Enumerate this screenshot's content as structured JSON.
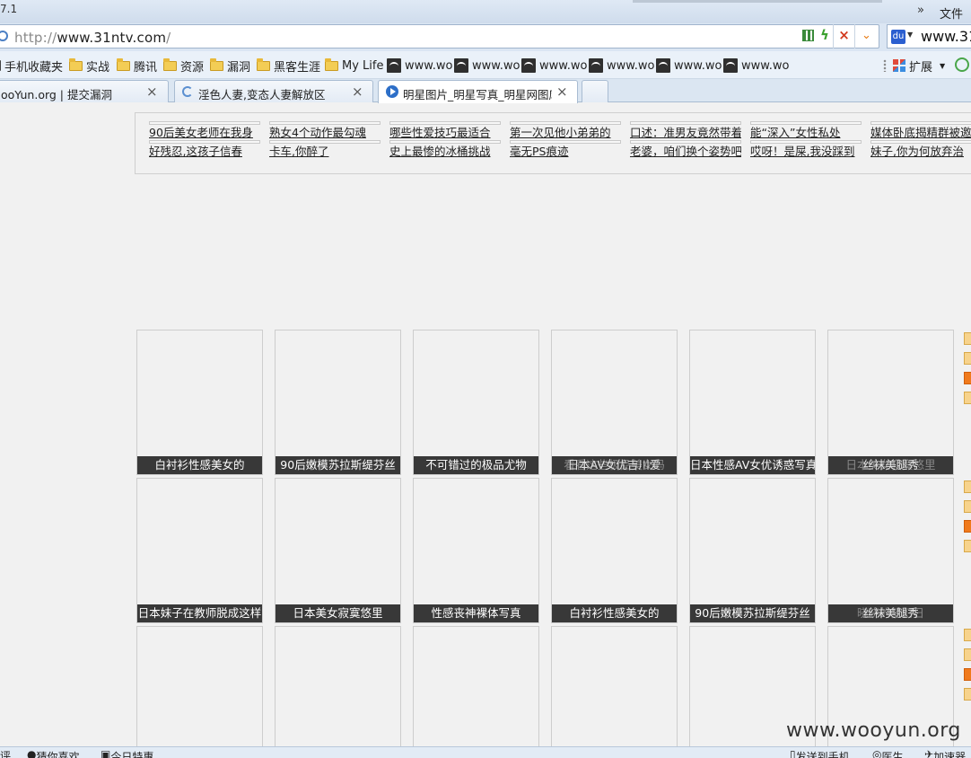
{
  "window": {
    "version": "7.1",
    "overflow_chevron": "»",
    "menu_file": "文件"
  },
  "address_bar": {
    "proto": "http://",
    "host": "www.31ntv.com",
    "path": "/",
    "stop_symbol": "×",
    "dropdown_symbol": "⌄"
  },
  "search_box": {
    "value": "www.31"
  },
  "bookmarks": {
    "mobile": "手机收藏夹",
    "folders": [
      "实战",
      "腾讯",
      "资源",
      "漏洞",
      "黑客生涯",
      "My Life"
    ],
    "sites": [
      "www.wo",
      "www.wo",
      "www.wo",
      "www.wo",
      "www.wo",
      "www.wo"
    ],
    "extensions": "扩展"
  },
  "tabs": [
    {
      "label": "ooYun.org | 提交漏洞",
      "close": "×",
      "state": "normal"
    },
    {
      "label": "淫色人妻,变态人妻解放区",
      "close": "×",
      "state": "loading"
    },
    {
      "label": "明星图片_明星写真_明星网图库",
      "close": "×",
      "state": "active"
    }
  ],
  "ad_links": [
    [
      "90后美女老师在我身",
      "好残忍,这孩子信春"
    ],
    [
      "熟女4个动作最勾魂",
      "卡车,你醉了"
    ],
    [
      "哪些性爱技巧最适合",
      "史上最惨的冰桶挑战"
    ],
    [
      "第一次见他小弟弟的",
      "毫无PS痕迹"
    ],
    [
      "口述：准男友竟然带着",
      "老婆，咱们换个姿势吧"
    ],
    [
      "能“深入”女性私处",
      "哎呀！是屎,我没踩到"
    ],
    [
      "媒体卧底揭精群被邀",
      "妹子,你为何放弃治"
    ]
  ],
  "gallery": {
    "row1": [
      "白衬衫性感美女的",
      "90后嫩模苏拉斯缇芬丝",
      "不可错过的极品尤物",
      "日本AV女优吉川爱",
      "日本性感AV女优诱惑写真",
      "丝袜美腿秀"
    ],
    "row2": [
      "日本妹子在教师脱成这样",
      "日本美女寂寞悠里",
      "性感丧神裸体写真",
      "白衬衫性感美女的",
      "90后嫩模苏拉斯缇芬丝",
      "丝袜美腿秀"
    ],
    "row1_overlay": [
      "",
      "",
      "",
      "看看这些极品美女吗",
      "",
      "日本美女寂寞悠里"
    ],
    "row2_overlay": [
      "",
      "",
      "",
      "",
      "",
      "晓晓的梦幻日"
    ]
  },
  "watermark": "www.wooyun.org",
  "status_bar": {
    "left": "评",
    "guess": "猜你喜欢",
    "today": "今日特惠",
    "send_phone": "发送到手机",
    "security": "医生",
    "accelerate": "加速器"
  }
}
